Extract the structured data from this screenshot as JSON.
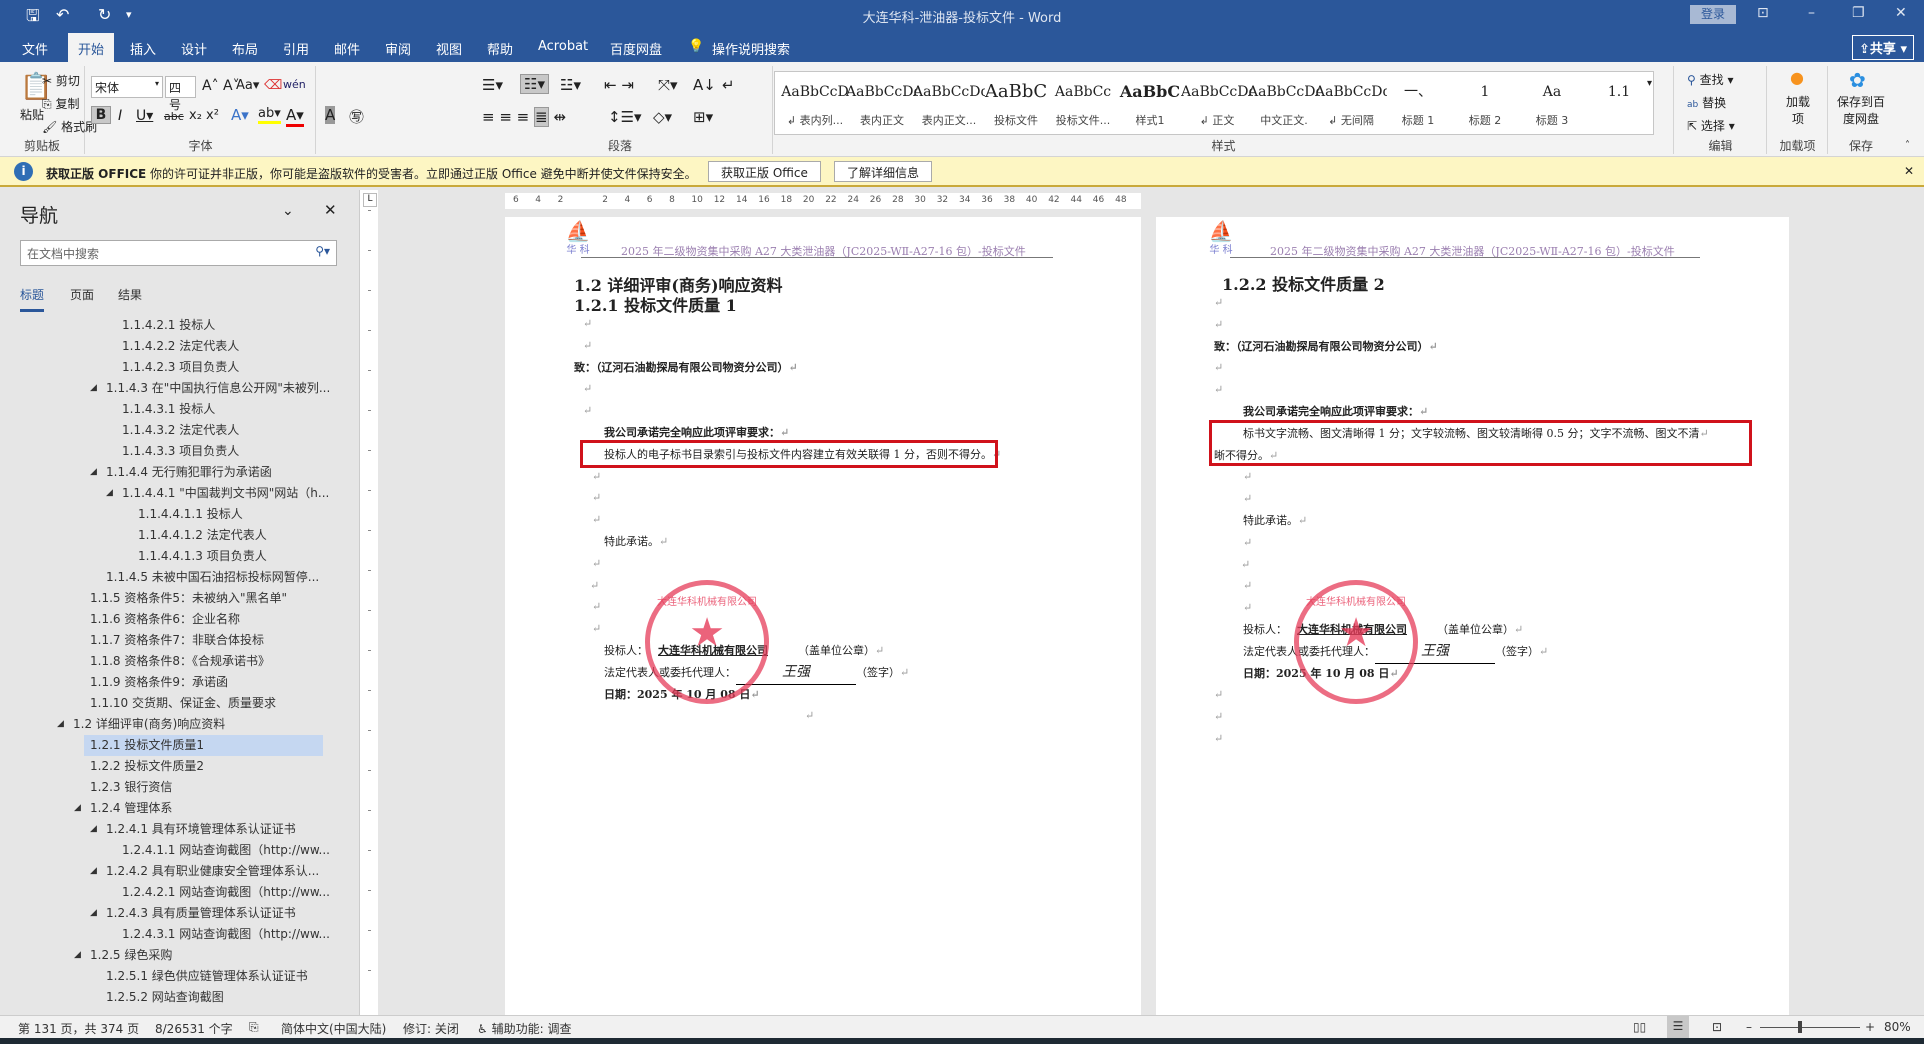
{
  "app": {
    "title": "大连华科-泄油器-投标文件  -  Word",
    "login": "登录",
    "share": "共享"
  },
  "tabs": [
    "文件",
    "开始",
    "插入",
    "设计",
    "布局",
    "引用",
    "邮件",
    "审阅",
    "视图",
    "帮助",
    "Acrobat",
    "百度网盘",
    "操作说明搜索"
  ],
  "ribbon": {
    "clipboard": {
      "paste": "粘贴",
      "cut": "剪切",
      "copy": "复制",
      "format_painter": "格式刷",
      "label": "剪贴板"
    },
    "font": {
      "name": "宋体",
      "size": "四号",
      "label": "字体"
    },
    "paragraph": {
      "label": "段落"
    },
    "styles": {
      "label": "样式",
      "items": [
        {
          "preview": "AaBbCcD",
          "name": "↲ 表内列..."
        },
        {
          "preview": "AaBbCcDdI",
          "name": "表内正文"
        },
        {
          "preview": "AaBbCcDd",
          "name": "表内正文..."
        },
        {
          "preview": "AaBbC",
          "name": "投标文件"
        },
        {
          "preview": "AaBbCc",
          "name": "投标文件..."
        },
        {
          "preview": "AaBbC",
          "name": "样式1"
        },
        {
          "preview": "AaBbCcDdI",
          "name": "↲ 正文"
        },
        {
          "preview": "AaBbCcDd",
          "name": "中文正文."
        },
        {
          "preview": "AaBbCcDdI",
          "name": "↲ 无间隔"
        },
        {
          "preview": "一、",
          "name": "标题 1"
        },
        {
          "preview": "1",
          "name": "标题 2"
        },
        {
          "preview": "Aa",
          "name": "标题 3"
        },
        {
          "preview": "1.1",
          "name": ""
        }
      ]
    },
    "editing": {
      "find": "查找",
      "replace": "替换",
      "select": "选择",
      "label": "编辑"
    },
    "addins": {
      "button": "加载项",
      "label": "加载项"
    },
    "save": {
      "button": "保存到百度网盘",
      "label": "保存"
    }
  },
  "infobar": {
    "title": "获取正版 OFFICE",
    "message": "你的许可证并非正版，你可能是盗版软件的受害者。立即通过正版 Office 避免中断并使文件保持安全。",
    "btn_get": "获取正版 Office",
    "btn_learn": "了解详细信息"
  },
  "nav": {
    "title": "导航",
    "search_placeholder": "在文档中搜索",
    "tabs": [
      "标题",
      "页面",
      "结果"
    ],
    "items": [
      {
        "t": "1.1.4.2.1 投标人",
        "l": 4
      },
      {
        "t": "1.1.4.2.2 法定代表人",
        "l": 4
      },
      {
        "t": "1.1.4.2.3 项目负责人",
        "l": 4
      },
      {
        "t": "1.1.4.3 在\"中国执行信息公开网\"未被列...",
        "l": 3,
        "e": true
      },
      {
        "t": "1.1.4.3.1 投标人",
        "l": 4
      },
      {
        "t": "1.1.4.3.2 法定代表人",
        "l": 4
      },
      {
        "t": "1.1.4.3.3 项目负责人",
        "l": 4
      },
      {
        "t": "1.1.4.4 无行贿犯罪行为承诺函",
        "l": 3,
        "e": true
      },
      {
        "t": "1.1.4.4.1 \"中国裁判文书网\"网站（h...",
        "l": 4,
        "e": true
      },
      {
        "t": "1.1.4.4.1.1 投标人",
        "l": 5
      },
      {
        "t": "1.1.4.4.1.2 法定代表人",
        "l": 5
      },
      {
        "t": "1.1.4.4.1.3 项目负责人",
        "l": 5
      },
      {
        "t": "1.1.4.5 未被中国石油招标投标网暂停...",
        "l": 3
      },
      {
        "t": "1.1.5 资格条件5：未被纳入\"黑名单\"",
        "l": 2
      },
      {
        "t": "1.1.6 资格条件6：企业名称",
        "l": 2
      },
      {
        "t": "1.1.7 资格条件7：非联合体投标",
        "l": 2
      },
      {
        "t": "1.1.8 资格条件8：《合规承诺书》",
        "l": 2
      },
      {
        "t": "1.1.9 资格条件9：承诺函",
        "l": 2
      },
      {
        "t": "1.1.10 交货期、保证金、质量要求",
        "l": 2
      },
      {
        "t": "1.2 详细评审(商务)响应资料",
        "l": 1,
        "e": true
      },
      {
        "t": "1.2.1 投标文件质量1",
        "l": 2,
        "s": true
      },
      {
        "t": "1.2.2 投标文件质量2",
        "l": 2
      },
      {
        "t": "1.2.3 银行资信",
        "l": 2
      },
      {
        "t": "1.2.4 管理体系",
        "l": 2,
        "e": true
      },
      {
        "t": "1.2.4.1 具有环境管理体系认证证书",
        "l": 3,
        "e": true
      },
      {
        "t": "1.2.4.1.1 网站查询截图（http://ww...",
        "l": 4
      },
      {
        "t": "1.2.4.2 具有职业健康安全管理体系认...",
        "l": 3,
        "e": true
      },
      {
        "t": "1.2.4.2.1 网站查询截图（http://ww...",
        "l": 4
      },
      {
        "t": "1.2.4.3 具有质量管理体系认证证书",
        "l": 3,
        "e": true
      },
      {
        "t": "1.2.4.3.1 网站查询截图（http://ww...",
        "l": 4
      },
      {
        "t": "1.2.5 绿色采购",
        "l": 2,
        "e": true
      },
      {
        "t": "1.2.5.1 绿色供应链管理体系认证证书",
        "l": 3
      },
      {
        "t": "1.2.5.2 网站查询截图",
        "l": 3
      }
    ]
  },
  "ruler": {
    "h": [
      "6",
      "4",
      "2",
      "",
      "2",
      "4",
      "6",
      "8",
      "10",
      "12",
      "14",
      "16",
      "18",
      "20",
      "22",
      "24",
      "26",
      "28",
      "30",
      "32",
      "34",
      "36",
      "38",
      "40",
      "42",
      "44",
      "46",
      "48"
    ]
  },
  "doc": {
    "header": "2025 年二级物资集中采购 A27 大类泄油器（JC2025-WⅡ-A27-16 包）-投标文件",
    "logo": "华 科",
    "stamp": "大连华科机械有限公司",
    "pm": "↵",
    "page1": {
      "h1": "1.2 详细评审(商务)响应资料",
      "h2": "1.2.1 投标文件质量 1",
      "to": "致：（辽河石油勘探局有限公司物资分公司）",
      "promise": "我公司承诺完全响应此项评审要求：",
      "req": "投标人的电子标书目录索引与投标文件内容建立有效关联得 1 分，否则不得分。"
    },
    "page2": {
      "h1": "1.2.2 投标文件质量 2",
      "to": "致：（辽河石油勘探局有限公司物资分公司）",
      "promise": "我公司承诺完全响应此项评审要求：",
      "req1": "标书文字流畅、图文清晰得 1 分；文字较流畅、图文较清晰得 0.5 分；文字不流畅、图文不清",
      "req2": "晰不得分。"
    },
    "closing": "特此承诺。",
    "bidder_label": "投标人：",
    "bidder": "大连华科机械有限公司",
    "seal_note": "（盖单位公章）",
    "rep_label": "法定代表人或委托代理人：",
    "signature": "王强",
    "sign_note": "（签字）",
    "date": "日期：2025 年 10 月 08 日"
  },
  "status": {
    "page": "第 131 页，共 374 页",
    "words": "8/26531 个字",
    "lang": "简体中文(中国大陆)",
    "track": "修订: 关闭",
    "access": "辅助功能: 调查",
    "zoom": "80%"
  }
}
